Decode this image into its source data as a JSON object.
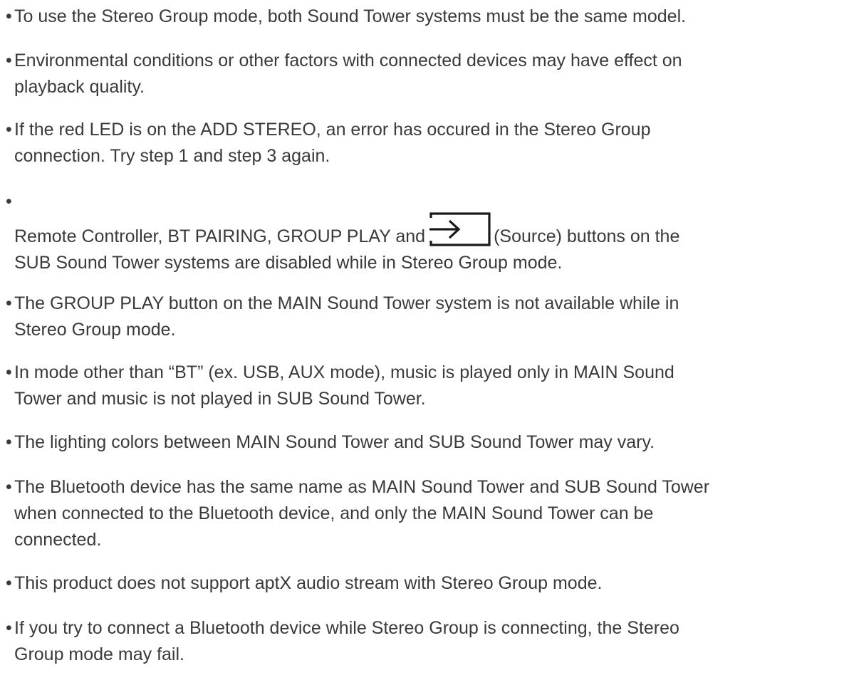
{
  "bullet": "•",
  "notes": {
    "item1": {
      "line1": "To use the Stereo Group mode, both Sound Tower systems must be the same model."
    },
    "item2": {
      "line1": "Environmental conditions or other factors with connected devices may have effect on",
      "line2": "playback quality."
    },
    "item3": {
      "line1": "If the red LED is on the ADD STEREO, an error has occured in the Stereo Group",
      "line2": "connection. Try step 1 and step 3 again."
    },
    "item4": {
      "line1_before_icon": "Remote Controller, BT PAIRING, GROUP PLAY and",
      "line1_after_icon": "(Source) buttons on the",
      "line2": "SUB Sound Tower systems are disabled while in Stereo Group mode.",
      "icon": "source-input-icon"
    },
    "item5": {
      "line1": "The GROUP PLAY button on the MAIN Sound Tower system is not available while in",
      "line2": "Stereo Group mode."
    },
    "item6": {
      "line1": "In mode other than “BT” (ex. USB, AUX mode), music is played only in MAIN Sound",
      "line2": "Tower and music is not played in SUB Sound Tower."
    },
    "item7": {
      "line1": "The lighting colors between MAIN Sound Tower and SUB Sound Tower may vary."
    },
    "item8": {
      "line1": "The Bluetooth device has the same name as MAIN Sound Tower and SUB Sound Tower",
      "line2": "when connected to the Bluetooth device, and only the MAIN Sound Tower can be",
      "line3": "connected."
    },
    "item9": {
      "line1": "This product does not support aptX audio stream with Stereo Group mode."
    },
    "item10": {
      "line1": "If you try to connect a Bluetooth device while Stereo Group is connecting, the Stereo",
      "line2": "Group mode may fail."
    }
  }
}
